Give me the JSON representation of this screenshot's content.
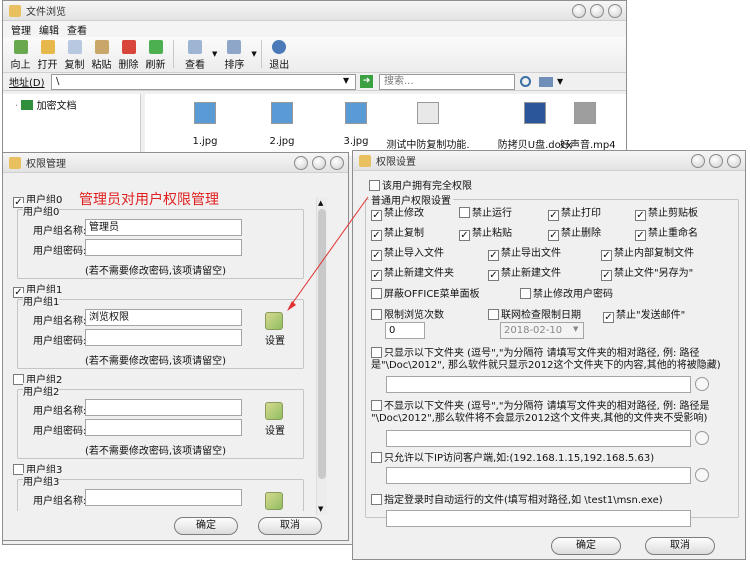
{
  "browser": {
    "title": "文件浏览",
    "menu": [
      "管理",
      "编辑",
      "查看"
    ],
    "toolbar": [
      "向上",
      "打开",
      "复制",
      "粘贴",
      "删除",
      "刷新",
      "查看",
      "排序",
      "退出"
    ],
    "address_label": "地址(D)",
    "address_value": "\\",
    "search_placeholder": "搜索...",
    "tree_item": "加密文档",
    "files": [
      {
        "name": "1.jpg",
        "icon": "image-icon"
      },
      {
        "name": "2.jpg",
        "icon": "image-icon"
      },
      {
        "name": "3.jpg",
        "icon": "image-icon"
      },
      {
        "name": "测试中防复制功能.",
        "icon": "document-icon"
      },
      {
        "name": "防拷贝U盘.docx",
        "icon": "word-icon"
      },
      {
        "name": "好声音.mp4",
        "icon": "video-icon"
      }
    ]
  },
  "perm_mgmt": {
    "title": "权限管理",
    "annotation": "管理员对用户权限管理",
    "groups": [
      {
        "check_label": "用户组0",
        "checked": true,
        "frame": "用户组0",
        "name_label": "用户组名称:",
        "name_value": "管理员",
        "pwd_label": "用户组密码:",
        "note": "(若不需要修改密码,该项请留空)"
      },
      {
        "check_label": "用户组1",
        "checked": true,
        "frame": "用户组1",
        "name_label": "用户组名称:",
        "name_value": "浏览权限",
        "pwd_label": "用户组密码:",
        "note": "(若不需要修改密码,该项请留空)",
        "setting": "设置"
      },
      {
        "check_label": "用户组2",
        "checked": false,
        "frame": "用户组2",
        "name_label": "用户组名称:",
        "name_value": "",
        "pwd_label": "用户组密码:",
        "note": "(若不需要修改密码,该项请留空)",
        "setting": "设置"
      },
      {
        "check_label": "用户组3",
        "checked": false,
        "frame": "用户组3",
        "name_label": "用户组名称:",
        "name_value": "",
        "pwd_label": "",
        "note": "",
        "setting": ""
      }
    ],
    "ok": "确定",
    "cancel": "取消"
  },
  "perm_set": {
    "title": "权限设置",
    "full": "该用户拥有完全权限",
    "section": "普通用户权限设置",
    "opts": [
      {
        "t": "禁止修改",
        "c": true
      },
      {
        "t": "禁止运行",
        "c": false
      },
      {
        "t": "禁止打印",
        "c": true
      },
      {
        "t": "禁止剪贴板",
        "c": true
      },
      {
        "t": "禁止复制",
        "c": true
      },
      {
        "t": "禁止粘贴",
        "c": true
      },
      {
        "t": "禁止删除",
        "c": true
      },
      {
        "t": "禁止重命名",
        "c": true
      },
      {
        "t": "禁止导入文件",
        "c": true
      },
      {
        "t": "禁止导出文件",
        "c": true
      },
      {
        "t": "禁止内部复制文件",
        "c": true
      },
      {
        "t": "禁止新建文件夹",
        "c": true
      },
      {
        "t": "禁止新建文件",
        "c": true
      },
      {
        "t": "禁止文件\"另存为\"",
        "c": true
      }
    ],
    "office": "屏蔽OFFICE菜单面板",
    "modpwd": "禁止修改用户密码",
    "limit_browse": "限制浏览次数",
    "limit_value": "0",
    "net_date": "联网检查限制日期",
    "date_value": "2018-02-10",
    "mail": "禁止\"发送邮件\"",
    "only_show": "只显示以下文件夹 (逗号\",\"为分隔符 请填写文件夹的相对路径, 例: 路径是\"\\Doc\\2012\", 那么软件就只显示2012这个文件夹下的内容,其他的将被隐藏)",
    "no_show": "不显示以下文件夹 (逗号\",\"为分隔符 请填写文件夹的相对路径, 例: 路径是 \"\\Doc\\2012\",那么软件将不会显示2012这个文件夹,其他的文件夹不受影响)",
    "ip_only": "只允许以下IP访问客户端,如:(192.168.1.15,192.168.5.63)",
    "autorun": "指定登录时自动运行的文件(填写相对路径,如 \\test1\\msn.exe)",
    "ok": "确定",
    "cancel": "取消"
  }
}
